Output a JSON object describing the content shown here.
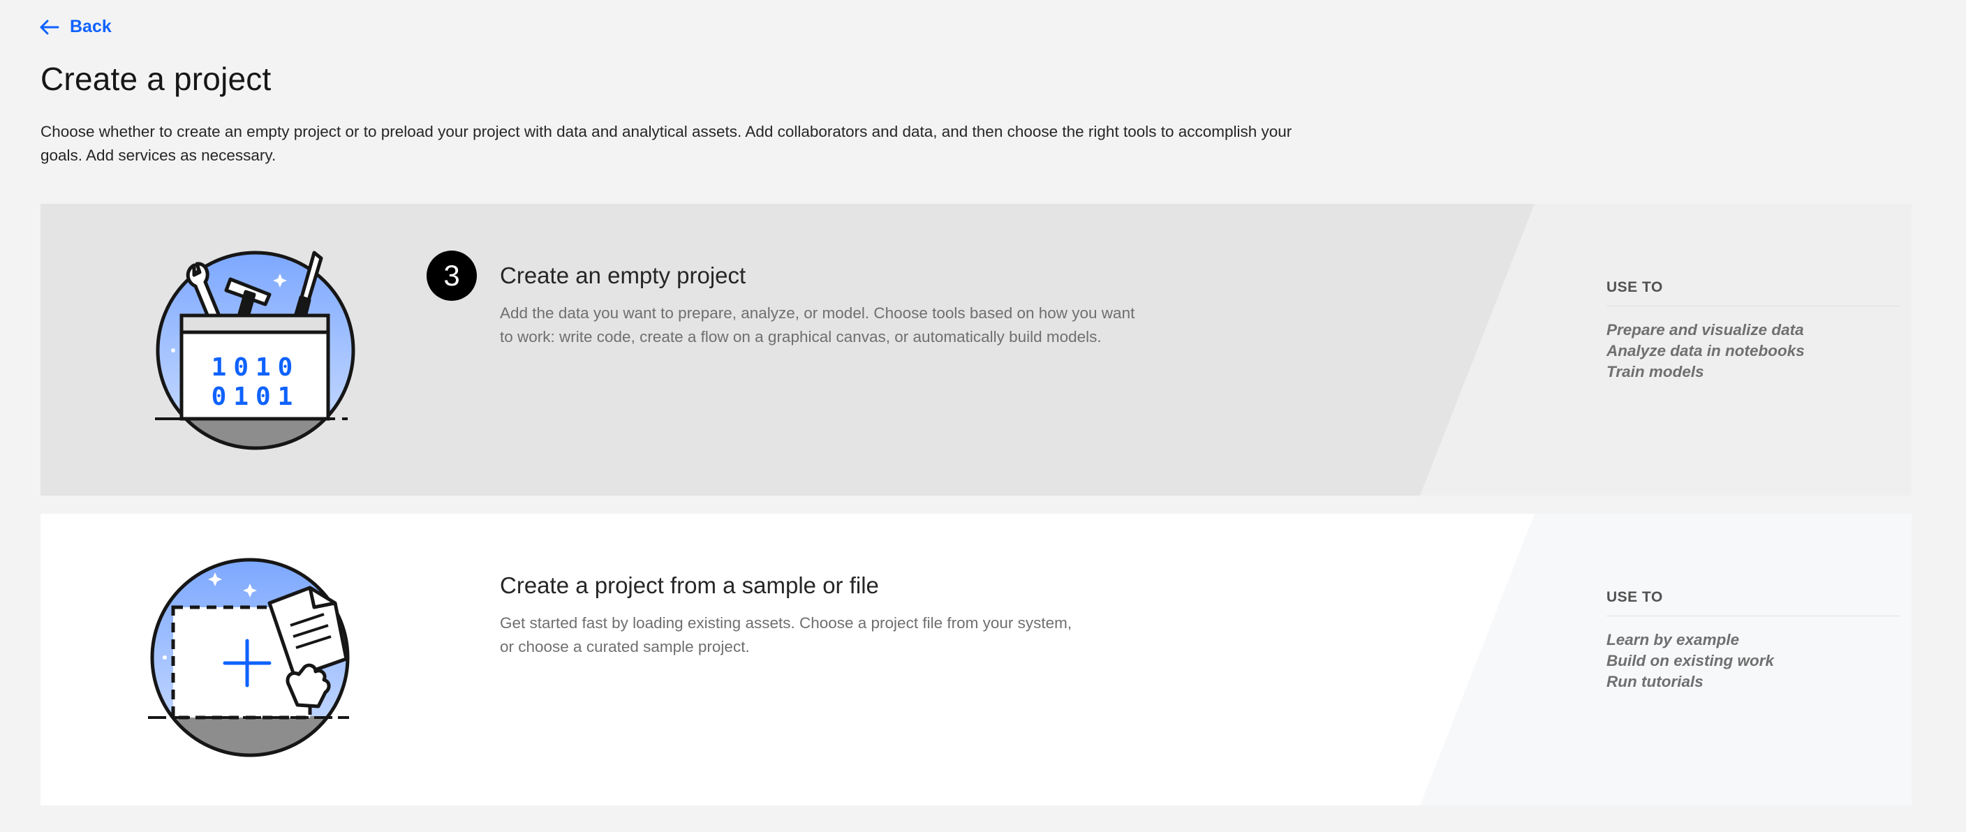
{
  "back": {
    "label": "Back"
  },
  "page": {
    "title": "Create a project",
    "description": "Choose whether to create an empty project or to preload your project with data and analytical assets. Add collaborators and data, and then choose the right tools to accomplish your goals. Add services as necessary."
  },
  "cards": [
    {
      "step_badge": "3",
      "title": "Create an empty project",
      "description": "Add the data you want to prepare, analyze, or model. Choose tools based on how you want to work: write code, create a flow on a graphical canvas, or automatically build models.",
      "illustration_icon": "toolbox-icon",
      "illustration_text": [
        "1010",
        "0101"
      ],
      "use_to_heading": "USE TO",
      "use_to_items": [
        "Prepare and visualize data",
        "Analyze data in notebooks",
        "Train models"
      ]
    },
    {
      "title": "Create a project from a sample or file",
      "description": "Get started fast by loading existing assets. Choose a project file from your system, or choose a curated sample project.",
      "illustration_icon": "import-file-icon",
      "use_to_heading": "USE TO",
      "use_to_items": [
        "Learn by example",
        "Build on existing work",
        "Run tutorials"
      ]
    }
  ],
  "colors": {
    "accent": "#0f62fe",
    "page_background": "#f3f3f3",
    "card_selected_background": "#e4e4e4",
    "card_background": "#ffffff",
    "illustration_sky": "#8fb3ff",
    "illustration_ground": "#8d8d8d"
  }
}
